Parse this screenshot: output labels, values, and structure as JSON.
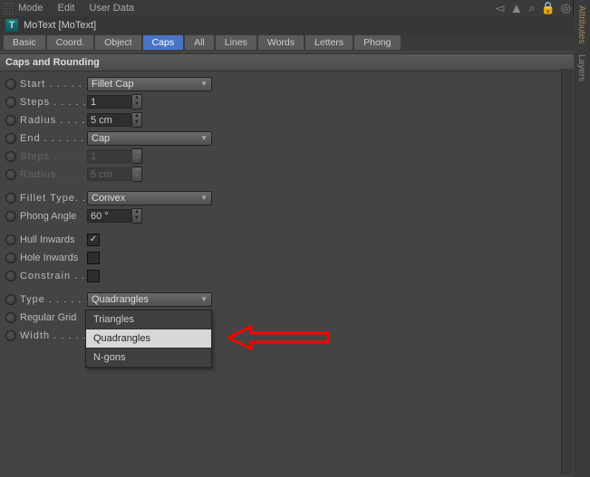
{
  "menubar": {
    "mode": "Mode",
    "edit": "Edit",
    "userdata": "User Data"
  },
  "title": "MoText [MoText]",
  "tabs": {
    "basic": "Basic",
    "coord": "Coord.",
    "object": "Object",
    "caps": "Caps",
    "all": "All",
    "lines": "Lines",
    "words": "Words",
    "letters": "Letters",
    "phong": "Phong"
  },
  "section": "Caps and Rounding",
  "labels": {
    "start": "Start . . . . . .",
    "steps": "Steps  . . . . .",
    "radius": "Radius  . . . .",
    "end": "End . . . . . . .",
    "steps2": "Steps  . . . . .",
    "radius2": "Radius  . . . .",
    "fillet": "Fillet Type. .",
    "phongang": "Phong Angle",
    "hull": "Hull Inwards",
    "hole": "Hole Inwards",
    "constrain": "Constrain . . .",
    "type": "Type  . . . . . .",
    "regular": "Regular Grid",
    "width": "Width . . . . . ."
  },
  "values": {
    "start": "Fillet Cap",
    "steps": "1",
    "radius": "5 cm",
    "end": "Cap",
    "steps2": "1",
    "radius2": "5 cm",
    "fillet": "Convex",
    "phongang": "60 °",
    "type": "Quadrangles"
  },
  "checks": {
    "hull": "✓"
  },
  "type_options": {
    "a": "Triangles",
    "b": "Quadrangles",
    "c": "N-gons"
  },
  "side": {
    "attr": "Attributes",
    "layers": "Layers"
  }
}
